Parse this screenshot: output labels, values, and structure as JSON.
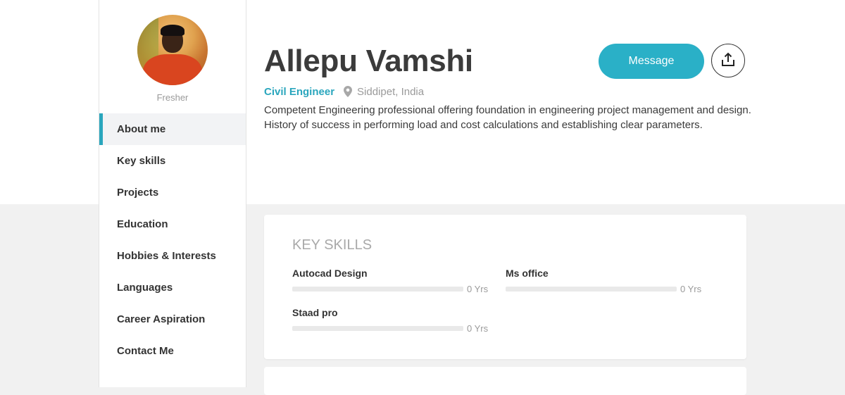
{
  "profile": {
    "status": "Fresher",
    "name": "Allepu Vamshi",
    "role": "Civil Engineer",
    "location": "Siddipet, India",
    "summary_lines": [
      "Competent Engineering professional offering foundation in engineering project management and design.",
      "History of success in performing load and cost calculations and establishing clear parameters."
    ]
  },
  "actions": {
    "message_label": "Message",
    "share_icon": "share-upload-icon"
  },
  "nav": {
    "items": [
      {
        "label": "About me",
        "active": true
      },
      {
        "label": "Key skills",
        "active": false
      },
      {
        "label": "Projects",
        "active": false
      },
      {
        "label": "Education",
        "active": false
      },
      {
        "label": "Hobbies & Interests",
        "active": false
      },
      {
        "label": "Languages",
        "active": false
      },
      {
        "label": "Career Aspiration",
        "active": false
      },
      {
        "label": "Contact Me",
        "active": false
      }
    ]
  },
  "key_skills": {
    "title": "KEY SKILLS",
    "skills": [
      {
        "name": "Autocad Design",
        "years": "0 Yrs",
        "level": 0
      },
      {
        "name": "Ms office",
        "years": "0 Yrs",
        "level": 0
      },
      {
        "name": "Staad pro",
        "years": "0 Yrs",
        "level": 0
      }
    ]
  },
  "colors": {
    "accent": "#2aa6bd",
    "button": "#2ab0c7",
    "page_bg": "#f1f1f1"
  }
}
